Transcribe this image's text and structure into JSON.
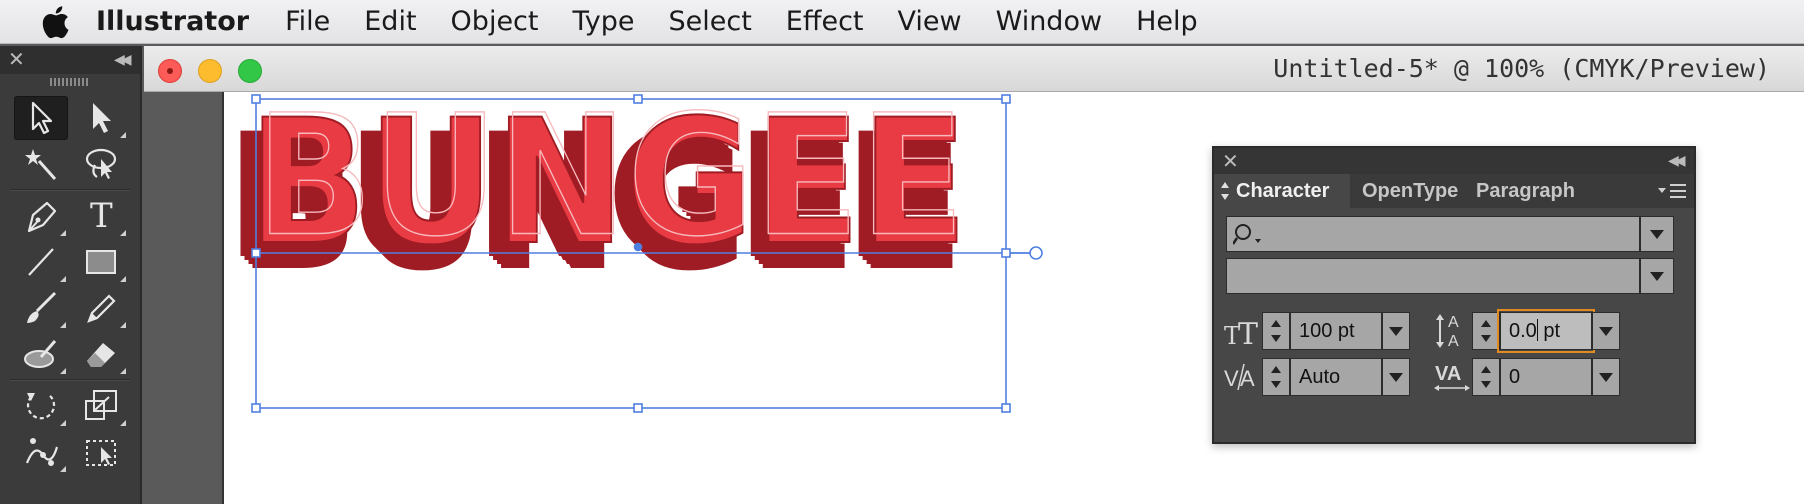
{
  "menubar": {
    "apple_icon": "apple-logo-icon",
    "items": [
      "Illustrator",
      "File",
      "Edit",
      "Object",
      "Type",
      "Select",
      "Effect",
      "View",
      "Window",
      "Help"
    ]
  },
  "tools_panel": {
    "tools": [
      "selection-tool-icon",
      "direct-selection-tool-icon",
      "magic-wand-tool-icon",
      "lasso-tool-icon",
      "pen-tool-icon",
      "type-tool-icon",
      "line-segment-tool-icon",
      "rectangle-tool-icon",
      "paintbrush-tool-icon",
      "pencil-tool-icon",
      "blob-brush-tool-icon",
      "eraser-tool-icon",
      "rotate-tool-icon",
      "scale-tool-icon",
      "puppet-warp-tool-icon",
      "free-transform-tool-icon"
    ],
    "type_tool_glyph": "T"
  },
  "document": {
    "title": "Untitled-5* @ 100% (CMYK/Preview)",
    "artwork_text": "BUNGEE",
    "colors": {
      "face": "#e93b43",
      "extrusion": "#a01c24",
      "inline": "#f7b9bd",
      "selection": "#4f7fe0"
    }
  },
  "character_panel": {
    "tabs": [
      "Character",
      "OpenType",
      "Paragraph"
    ],
    "font_family": "",
    "font_style": "",
    "font_size": "100 pt",
    "leading_value": "0.0",
    "leading_unit": "pt",
    "kerning": "Auto",
    "tracking": "0"
  }
}
